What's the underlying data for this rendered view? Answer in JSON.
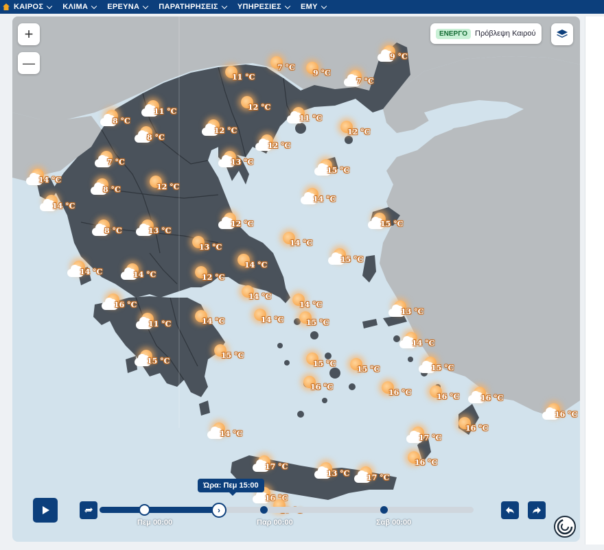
{
  "nav": {
    "items": [
      {
        "label": "ΚΑΙΡΟΣ"
      },
      {
        "label": "ΚΛΙΜΑ"
      },
      {
        "label": "ΕΡΕΥΝΑ"
      },
      {
        "label": "ΠΑΡΑΤΗΡΗΣΕΙΣ"
      },
      {
        "label": "ΥΠΗΡΕΣΙΕΣ"
      },
      {
        "label": "ΕΜΥ"
      }
    ]
  },
  "controls": {
    "zoom_in": "+",
    "zoom_out": "—",
    "forecast_badge": "ΕΝΕΡΓΟ",
    "forecast_label": "Πρόβλεψη Καιρού",
    "layers_icon": "layers-icon"
  },
  "timeline": {
    "tooltip": "Ώρα: Πεμ 15:00",
    "ticks": [
      "Πεμ 00:00",
      "Παρ 00:00",
      "Σαβ 00:00"
    ]
  },
  "colors": {
    "nav": "#0c3f7c",
    "sea": "#d2e2ec",
    "greece_land": "#4a525b",
    "neighbor_land": "#b8bcbf",
    "sun": "#f59a3a"
  },
  "stations": [
    {
      "temp": "7 °C",
      "icon": "sun"
    },
    {
      "temp": "9 °C",
      "icon": "sun"
    },
    {
      "temp": "9 °C",
      "icon": "cloud"
    },
    {
      "temp": "11 °C",
      "icon": "sun"
    },
    {
      "temp": "7 °C",
      "icon": "cloud"
    },
    {
      "temp": "11 °C",
      "icon": "cloud"
    },
    {
      "temp": "12 °C",
      "icon": "sun"
    },
    {
      "temp": "8 °C",
      "icon": "cloud"
    },
    {
      "temp": "11 °C",
      "icon": "cloud"
    },
    {
      "temp": "12 °C",
      "icon": "cloud"
    },
    {
      "temp": "12 °C",
      "icon": "sun"
    },
    {
      "temp": "8 °C",
      "icon": "cloud"
    },
    {
      "temp": "12 °C",
      "icon": "cloud"
    },
    {
      "temp": "7 °C",
      "icon": "cloud"
    },
    {
      "temp": "13 °C",
      "icon": "cloud"
    },
    {
      "temp": "14 °C",
      "icon": "cloud"
    },
    {
      "temp": "15 °C",
      "icon": "cloud"
    },
    {
      "temp": "8 °C",
      "icon": "cloud"
    },
    {
      "temp": "12 °C",
      "icon": "sun"
    },
    {
      "temp": "14 °C",
      "icon": "cloud"
    },
    {
      "temp": "14 °C",
      "icon": "cloud"
    },
    {
      "temp": "15 °C",
      "icon": "cloud"
    },
    {
      "temp": "8 °C",
      "icon": "cloud"
    },
    {
      "temp": "12 °C",
      "icon": "cloud"
    },
    {
      "temp": "13 °C",
      "icon": "cloud"
    },
    {
      "temp": "13 °C",
      "icon": "sun"
    },
    {
      "temp": "14 °C",
      "icon": "sun"
    },
    {
      "temp": "15 °C",
      "icon": "cloud"
    },
    {
      "temp": "14 °C",
      "icon": "cloud"
    },
    {
      "temp": "14 °C",
      "icon": "cloud"
    },
    {
      "temp": "12 °C",
      "icon": "sun"
    },
    {
      "temp": "14 °C",
      "icon": "sun"
    },
    {
      "temp": "14 °C",
      "icon": "sun"
    },
    {
      "temp": "16 °C",
      "icon": "cloud"
    },
    {
      "temp": "14 °C",
      "icon": "sun"
    },
    {
      "temp": "11 °C",
      "icon": "cloud"
    },
    {
      "temp": "14 °C",
      "icon": "sun"
    },
    {
      "temp": "14 °C",
      "icon": "sun"
    },
    {
      "temp": "15 °C",
      "icon": "sun"
    },
    {
      "temp": "13 °C",
      "icon": "cloud"
    },
    {
      "temp": "14 °C",
      "icon": "cloud"
    },
    {
      "temp": "15 °C",
      "icon": "cloud"
    },
    {
      "temp": "15 °C",
      "icon": "sun"
    },
    {
      "temp": "15 °C",
      "icon": "sun"
    },
    {
      "temp": "15 °C",
      "icon": "sun"
    },
    {
      "temp": "15 °C",
      "icon": "cloud"
    },
    {
      "temp": "16 °C",
      "icon": "sun"
    },
    {
      "temp": "16 °C",
      "icon": "sun"
    },
    {
      "temp": "16 °C",
      "icon": "sun"
    },
    {
      "temp": "16 °C",
      "icon": "cloud"
    },
    {
      "temp": "16 °C",
      "icon": "sun"
    },
    {
      "temp": "16 °C",
      "icon": "cloud"
    },
    {
      "temp": "14 °C",
      "icon": "cloud"
    },
    {
      "temp": "17 °C",
      "icon": "cloud"
    },
    {
      "temp": "16 °C",
      "icon": "sun"
    },
    {
      "temp": "17 °C",
      "icon": "cloud"
    },
    {
      "temp": "13 °C",
      "icon": "cloud"
    },
    {
      "temp": "17 °C",
      "icon": "cloud"
    },
    {
      "temp": "16 °C",
      "icon": "cloud"
    },
    {
      "temp": "17 °C",
      "icon": "sun"
    }
  ]
}
